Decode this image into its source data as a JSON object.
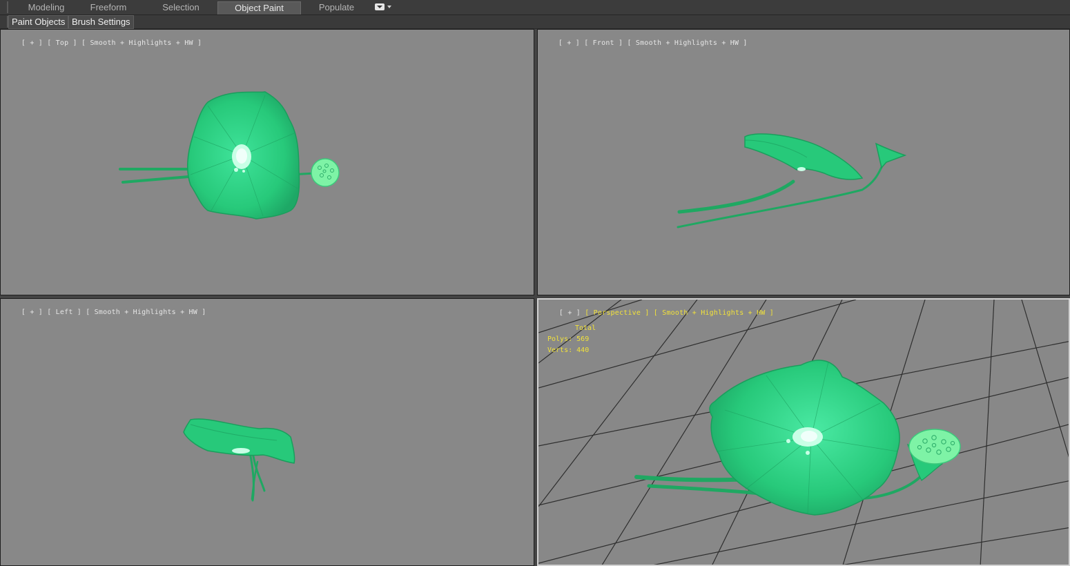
{
  "ribbon": {
    "tabs": [
      {
        "label": "Modeling",
        "active": false
      },
      {
        "label": "Freeform",
        "active": false
      },
      {
        "label": "Selection",
        "active": false
      },
      {
        "label": "Object Paint",
        "active": true
      },
      {
        "label": "Populate",
        "active": false
      }
    ],
    "menu_icon": "ribbon-options-icon",
    "panel_buttons": [
      "Paint Objects",
      "Brush Settings"
    ]
  },
  "viewports": {
    "top": {
      "plus": "[ + ]",
      "view": "[ Top ]",
      "shading": "[ Smooth + Highlights + HW ]"
    },
    "front": {
      "plus": "[ + ]",
      "view": "[ Front ]",
      "shading": "[ Smooth + Highlights + HW ]"
    },
    "left": {
      "plus": "[ + ]",
      "view": "[ Left ]",
      "shading": "[ Smooth + Highlights + HW ]"
    },
    "perspective": {
      "plus": "[ + ]",
      "view": "[ Perspective ]",
      "shading": "[ Smooth + Highlights + HW ]",
      "stats": {
        "header": "Total",
        "polys_label": "Polys:",
        "polys": "569",
        "verts_label": "Verts:",
        "verts": "440"
      }
    }
  },
  "colors": {
    "viewport_bg": "#888888",
    "leaf": "#27c97a",
    "leaf_dark": "#1a9e5c",
    "stem": "#1fa862",
    "highlight": "#d8fff0",
    "stats_text": "#f2e23a",
    "grid": "#2e2e2e"
  }
}
